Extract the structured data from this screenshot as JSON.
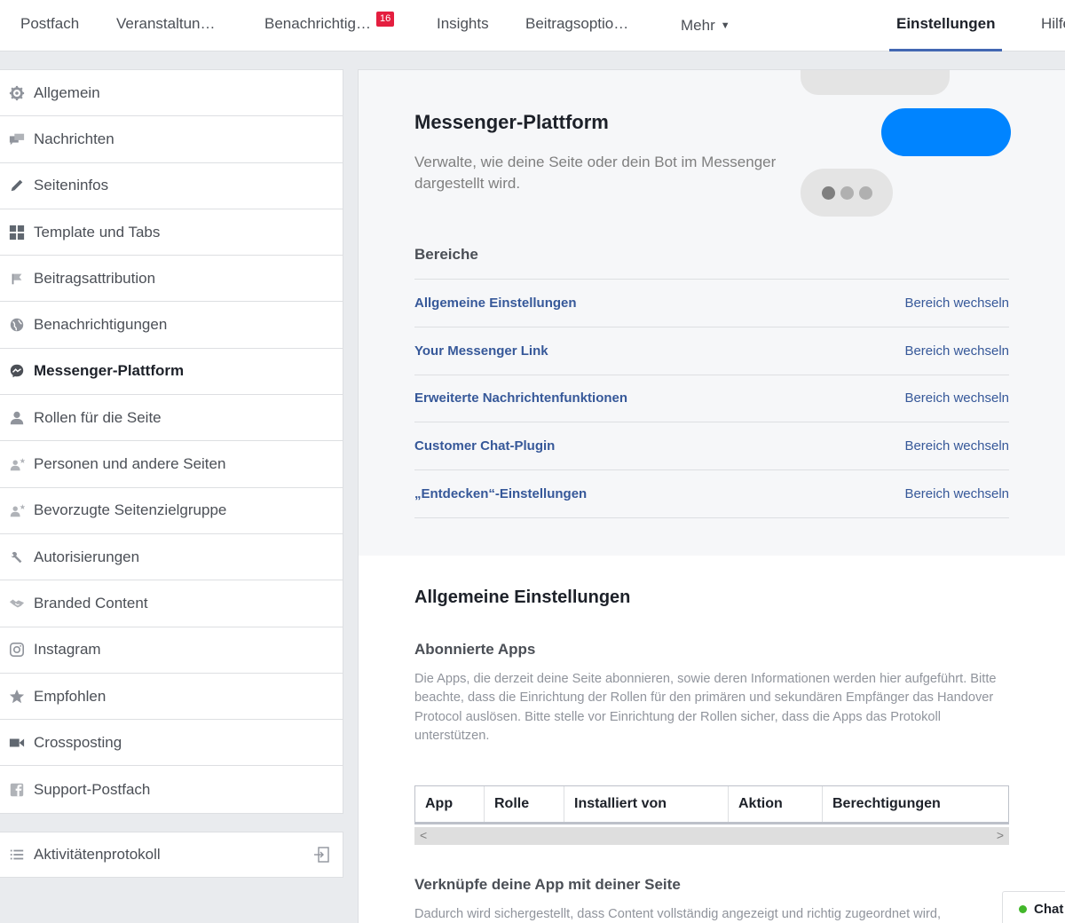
{
  "nav": {
    "tabs": [
      {
        "label": "Postfach"
      },
      {
        "label": "Veranstaltun…"
      },
      {
        "label": "Benachrichtig…",
        "badge": "16"
      },
      {
        "label": "Insights"
      },
      {
        "label": "Beitragsoptio…"
      },
      {
        "label": "Mehr"
      },
      {
        "label": "Einstellungen"
      },
      {
        "label": "Hilfe"
      }
    ],
    "accent": "#4267b2"
  },
  "sidebar": {
    "items": [
      {
        "label": "Allgemein",
        "icon": "gear-icon"
      },
      {
        "label": "Nachrichten",
        "icon": "messages-icon"
      },
      {
        "label": "Seiteninfos",
        "icon": "pencil-icon"
      },
      {
        "label": "Template und Tabs",
        "icon": "grid-icon"
      },
      {
        "label": "Beitragsattribution",
        "icon": "flag-icon"
      },
      {
        "label": "Benachrichtigungen",
        "icon": "globe-icon"
      },
      {
        "label": "Messenger-Plattform",
        "icon": "messenger-icon",
        "active": true
      },
      {
        "label": "Rollen für die Seite",
        "icon": "person-icon"
      },
      {
        "label": "Personen und andere Seiten",
        "icon": "person-star-icon"
      },
      {
        "label": "Bevorzugte Seitenzielgruppe",
        "icon": "person-star-icon"
      },
      {
        "label": "Autorisierungen",
        "icon": "wrench-icon"
      },
      {
        "label": "Branded Content",
        "icon": "handshake-icon"
      },
      {
        "label": "Instagram",
        "icon": "instagram-icon"
      },
      {
        "label": "Empfohlen",
        "icon": "star-icon"
      },
      {
        "label": "Crossposting",
        "icon": "video-icon"
      },
      {
        "label": "Support-Postfach",
        "icon": "facebook-icon"
      }
    ],
    "activity_log": {
      "label": "Aktivitätenprotokoll"
    }
  },
  "hero": {
    "title": "Messenger-Plattform",
    "description": "Verwalte, wie deine Seite oder dein Bot im Messenger dargestellt wird.",
    "messenger_blue": "#0084ff"
  },
  "areas": {
    "heading": "Bereiche",
    "items": [
      {
        "name": "Allgemeine Einstellungen",
        "action": "Bereich wechseln"
      },
      {
        "name": "Your Messenger Link",
        "action": "Bereich wechseln"
      },
      {
        "name": "Erweiterte Nachrichtenfunktionen",
        "action": "Bereich wechseln"
      },
      {
        "name": "Customer Chat-Plugin",
        "action": "Bereich wechseln"
      },
      {
        "name": "„Entdecken“-Einstellungen",
        "action": "Bereich wechseln"
      }
    ]
  },
  "general": {
    "title": "Allgemeine Einstellungen",
    "subscribed_apps": {
      "title": "Abonnierte Apps",
      "description": "Die Apps, die derzeit deine Seite abonnieren, sowie deren Informationen werden hier aufgeführt. Bitte beachte, dass die Einrichtung der Rollen für den primären und sekundären Empfänger das Handover Protocol auslösen. Bitte stelle vor Einrichtung der Rollen sicher, dass die Apps das Protokoll unterstützen.",
      "columns": [
        "App",
        "Rolle",
        "Installiert von",
        "Aktion",
        "Berechtigungen"
      ]
    },
    "link_app": {
      "title": "Verknüpfe deine App mit deiner Seite",
      "description": "Dadurch wird sichergestellt, dass Content vollständig angezeigt und richtig zugeordnet wird,"
    }
  },
  "chat": {
    "label": "Chat",
    "status_color": "#42b72a"
  }
}
